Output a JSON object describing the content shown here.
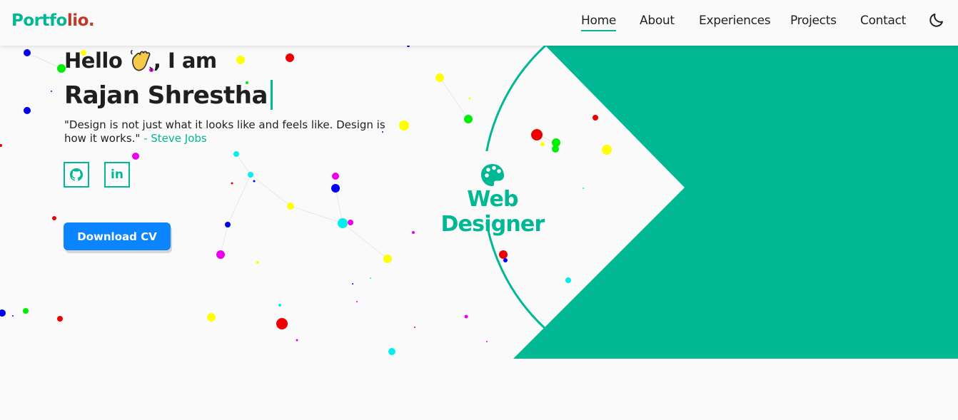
{
  "navbar": {
    "brand_part1": "Portfo",
    "brand_part2": "lio.",
    "links": [
      {
        "label": "Home",
        "active": true
      },
      {
        "label": "About",
        "active": false
      },
      {
        "label": "Experiences",
        "active": false
      },
      {
        "label": "Projects",
        "active": false
      },
      {
        "label": "Contact",
        "active": false
      }
    ],
    "theme_icon": "moon-icon"
  },
  "hero": {
    "greeting_before": "Hello ",
    "greeting_after": ", I am",
    "wave_icon": "waving-hand-icon",
    "name": "Rajan Shrestha",
    "quote_text": "\"Design is not just what it looks like and feels like. Design is how it works.\"",
    "quote_author": " - Steve Jobs",
    "social": [
      {
        "icon": "github-icon"
      },
      {
        "icon": "linkedin-icon",
        "text": "in"
      }
    ],
    "cv_button": "Download CV",
    "role_icon": "palette-icon",
    "role_text": "Web Designer"
  },
  "colors": {
    "accent": "#00b894",
    "brand_red": "#c0392b",
    "button_blue": "#0a84ff",
    "background": "#fafafa"
  }
}
